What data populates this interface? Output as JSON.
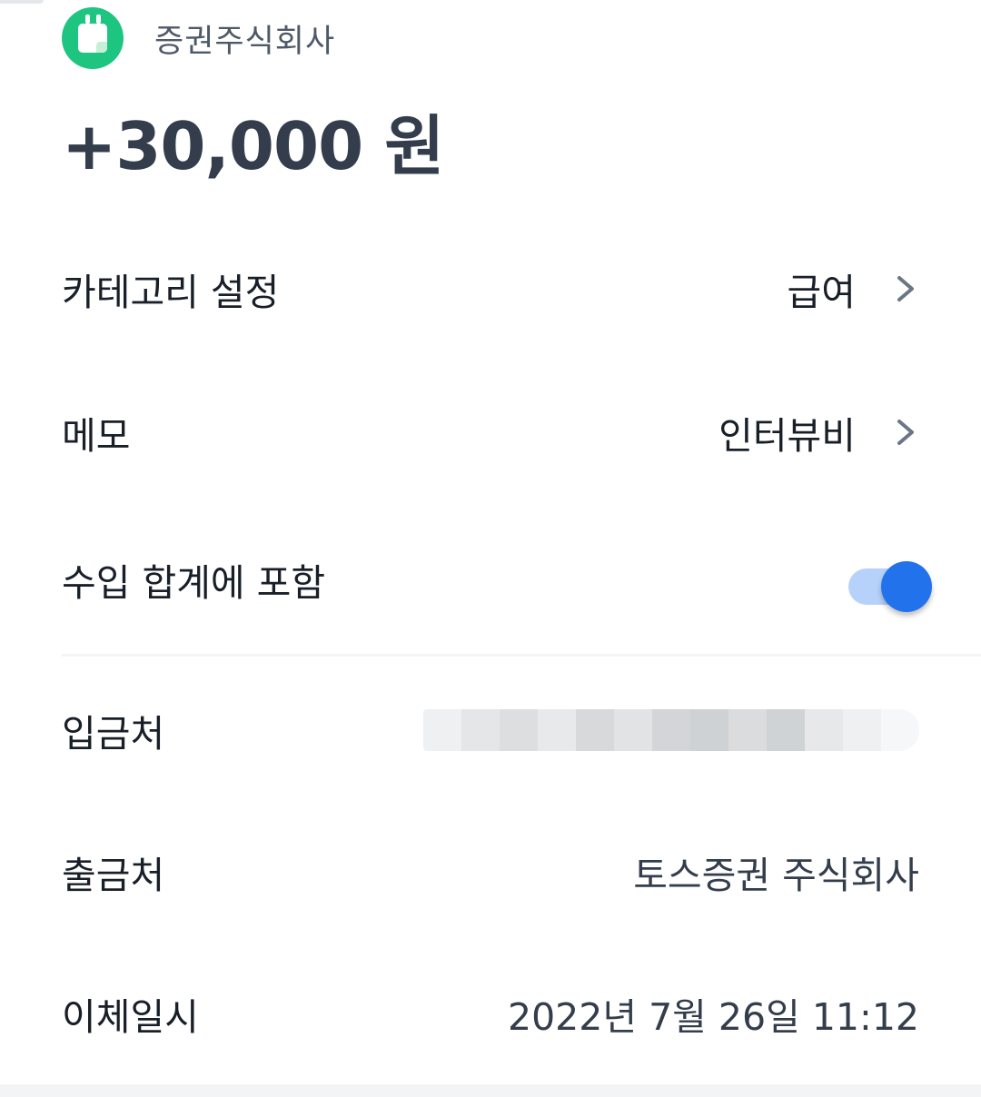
{
  "header": {
    "logo_icon": "memo-document-icon",
    "sender": "증권주식회사"
  },
  "amount": "+30,000 원",
  "details": {
    "category": {
      "label": "카테고리 설정",
      "value": "급여"
    },
    "memo": {
      "label": "메모",
      "value": "인터뷰비"
    },
    "include_income": {
      "label": "수입 합계에 포함",
      "enabled": true
    },
    "depositor": {
      "label": "입금처",
      "value_hidden": true
    },
    "withdrawer": {
      "label": "출금처",
      "value": "토스증권 주식회사"
    },
    "transfer_date": {
      "label": "이체일시",
      "value": "2022년 7월 26일 11:12"
    }
  },
  "colors": {
    "logo_green": "#1ec581",
    "toggle_on": "#2272eb",
    "toggle_track": "#b7d2fa",
    "text_primary": "#191f28",
    "text_secondary": "#4e5968"
  }
}
